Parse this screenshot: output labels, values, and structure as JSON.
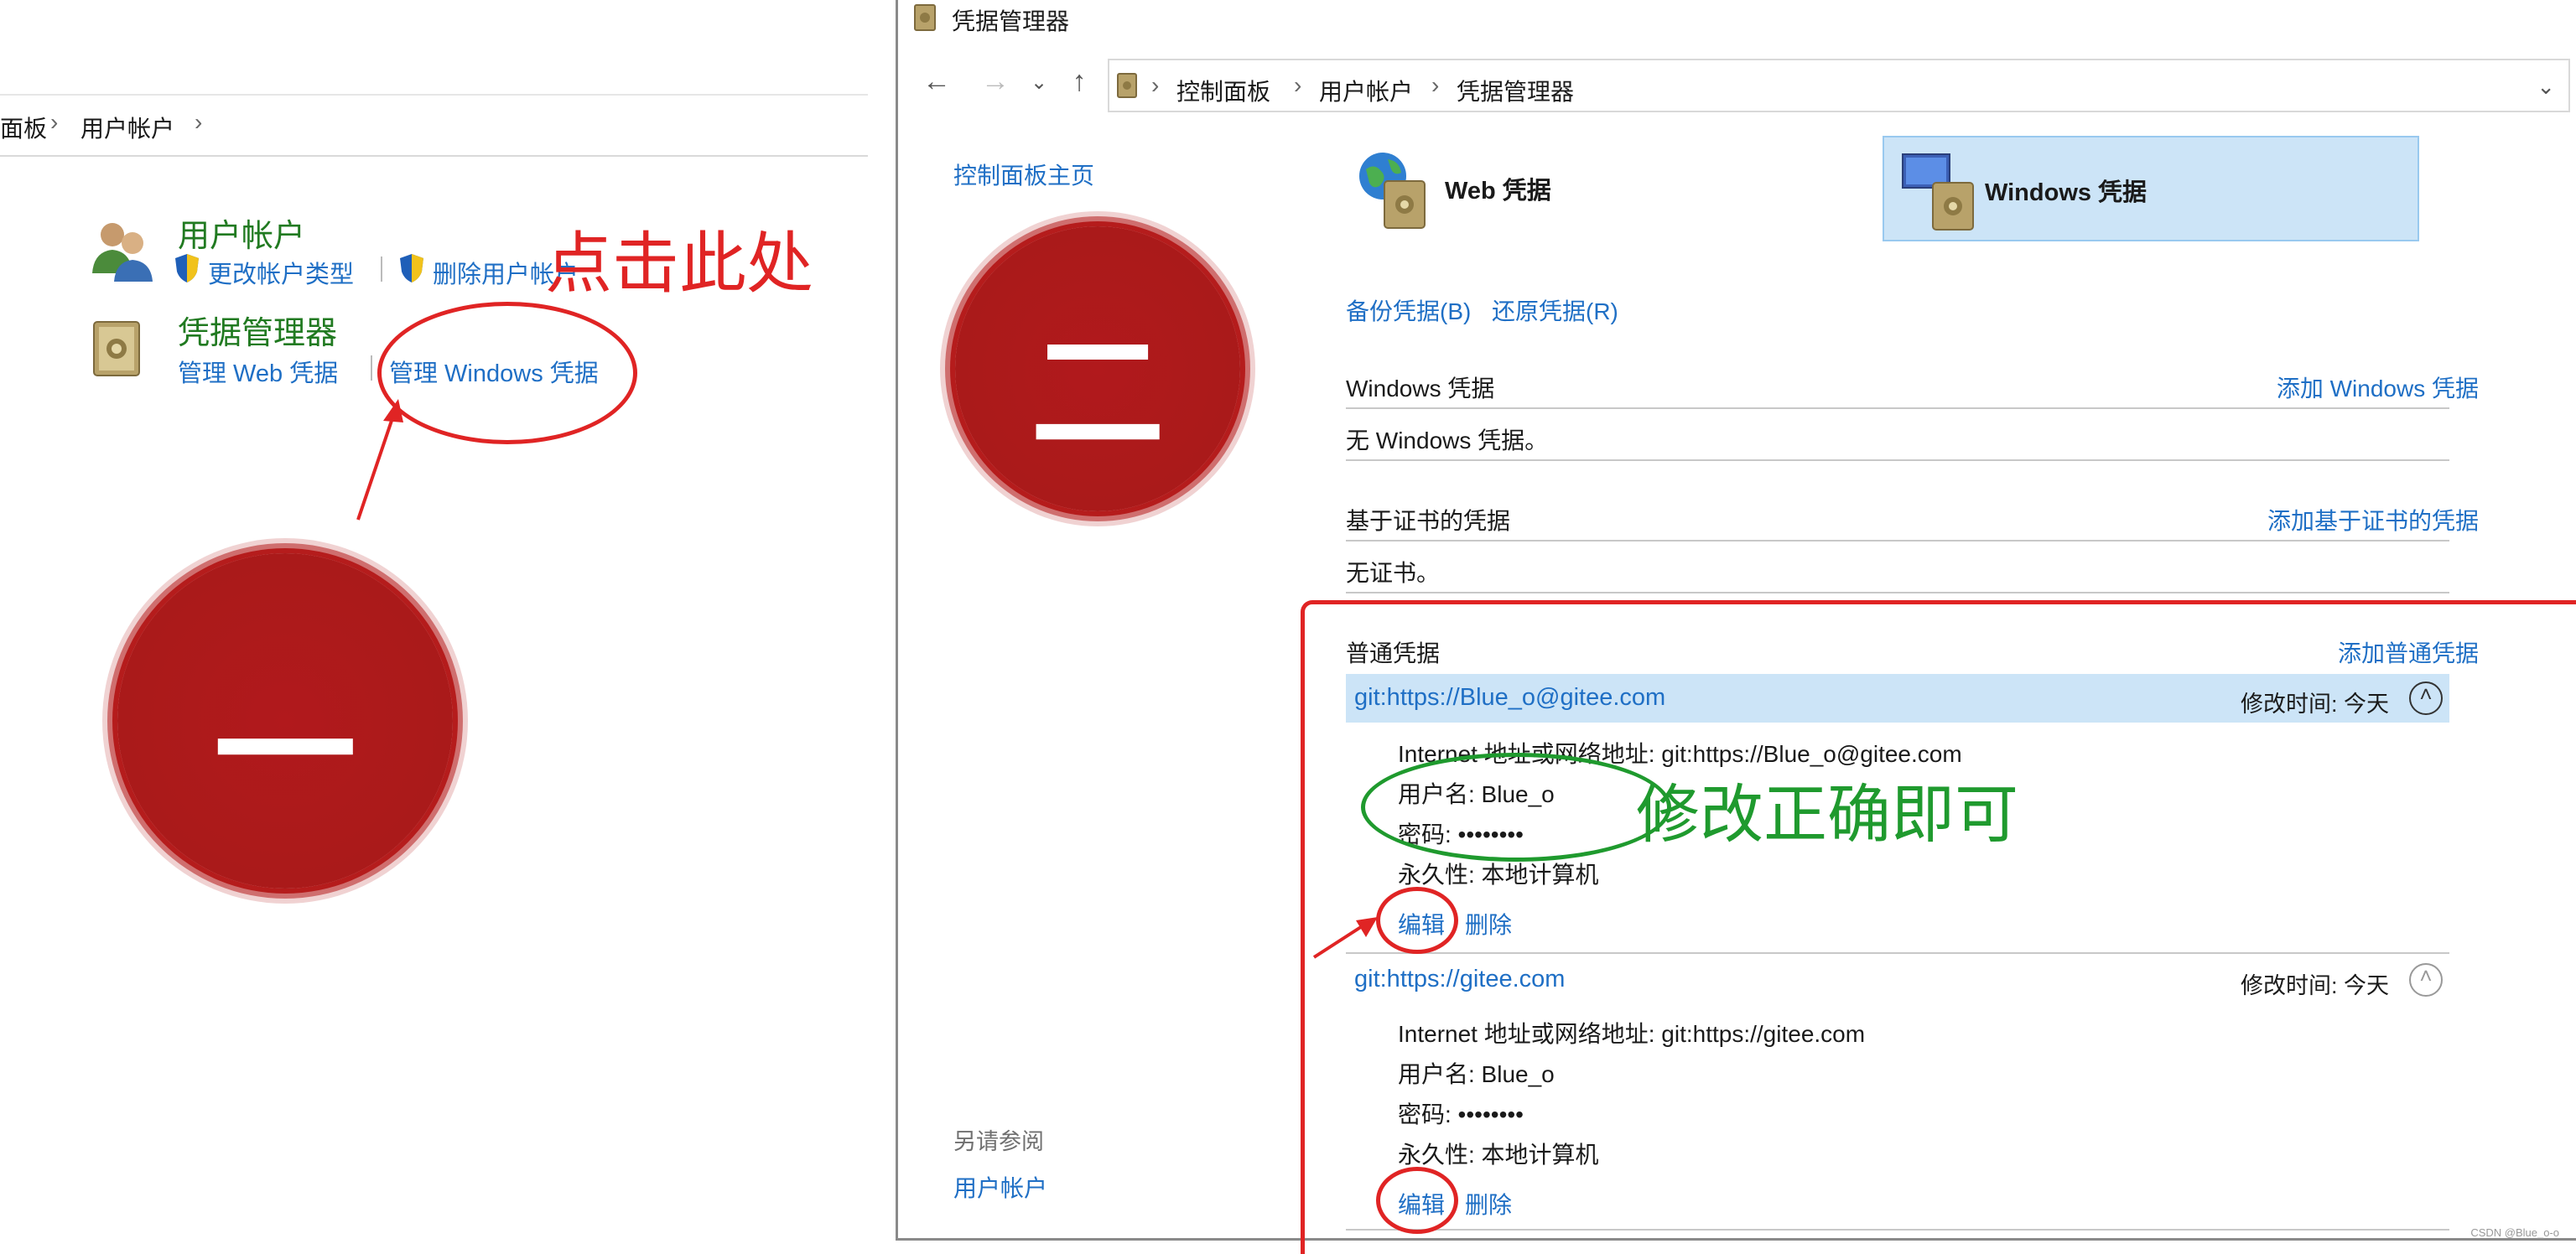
{
  "left": {
    "breadcrumb": [
      "面板",
      "用户帐户"
    ],
    "user_accounts": {
      "title": "用户帐户",
      "links": [
        "更改帐户类型",
        "删除用户帐户"
      ]
    },
    "credential_manager": {
      "title": "凭据管理器",
      "links": [
        "管理 Web 凭据",
        "管理 Windows 凭据"
      ]
    },
    "annotation_click": "点击此处",
    "stamp_one": "一"
  },
  "window": {
    "title": "凭据管理器",
    "breadcrumb": [
      "控制面板",
      "用户帐户",
      "凭据管理器"
    ],
    "sidebar": {
      "home": "控制面板主页",
      "see_also": "另请参阅",
      "see_also_link": "用户帐户"
    },
    "tabs": [
      {
        "label": "Web 凭据",
        "selected": false
      },
      {
        "label": "Windows 凭据",
        "selected": true
      }
    ],
    "actions": {
      "backup": "备份凭据(B)",
      "restore": "还原凭据(R)"
    },
    "sections": {
      "windows": {
        "title": "Windows 凭据",
        "action": "添加 Windows 凭据",
        "empty": "无 Windows 凭据。"
      },
      "cert": {
        "title": "基于证书的凭据",
        "action": "添加基于证书的凭据",
        "empty": "无证书。"
      },
      "generic": {
        "title": "普通凭据",
        "action": "添加普通凭据"
      }
    },
    "credentials": [
      {
        "name": "git:https://Blue_o@gitee.com",
        "modified": "修改时间:  今天",
        "address": "Internet 地址或网络地址:  git:https://Blue_o@gitee.com",
        "username": "用户名:  Blue_o",
        "password": "密码:  ••••••••",
        "persistence": "永久性:  本地计算机",
        "edit": "编辑",
        "delete": "删除"
      },
      {
        "name": "git:https://gitee.com",
        "modified": "修改时间:  今天",
        "address": "Internet 地址或网络地址:  git:https://gitee.com",
        "username": "用户名:  Blue_o",
        "password": "密码:  ••••••••",
        "persistence": "永久性:  本地计算机",
        "edit": "编辑",
        "delete": "删除"
      }
    ],
    "annotation_fix": "修改正确即可",
    "stamp_two": "二"
  },
  "watermark": "CSDN @Blue_o-o",
  "colors": {
    "link": "#1f6fc5",
    "category_green": "#217a21",
    "annotation_red": "#e02424",
    "annotation_green": "#1f9a2e",
    "stamp_red": "#b1191c",
    "selected_bg": "#cce4f7"
  },
  "icons": [
    "users-icon",
    "shield-icon",
    "vault-icon",
    "globe-vault-icon",
    "computer-vault-icon"
  ]
}
